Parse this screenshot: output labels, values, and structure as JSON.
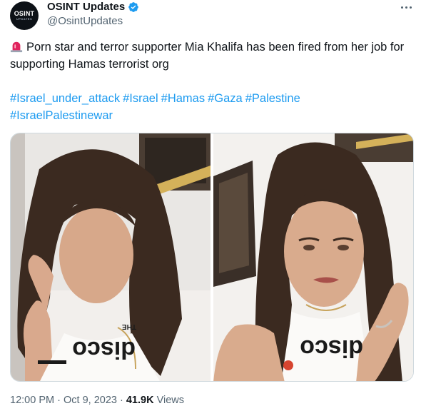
{
  "account": {
    "display_name": "OSINT Updates",
    "handle": "@OsintUpdates",
    "avatar_text": "OSINT",
    "avatar_subtext": "UPDATES",
    "verified": true
  },
  "tweet": {
    "text": "Porn star and terror supporter Mia Khalifa has been fired from her job for supporting Hamas terrorist org",
    "hashtags": [
      "#Israel_under_attack",
      "#Israel",
      "#Hamas",
      "#Gaza",
      "#Palestine",
      "#IsraelPalestinewar"
    ]
  },
  "media": {
    "shirt_text_left": "THE",
    "shirt_text_main": "disco"
  },
  "meta": {
    "time": "12:00 PM",
    "separator": "·",
    "date": "Oct 9, 2023",
    "views_count": "41.9K",
    "views_label": "Views"
  },
  "colors": {
    "link": "#1d9bf0",
    "muted": "#536471",
    "verified": "#1d9bf0",
    "siren": "#e0245e"
  },
  "icons": [
    "verified-badge-icon",
    "more-icon",
    "siren-icon"
  ]
}
